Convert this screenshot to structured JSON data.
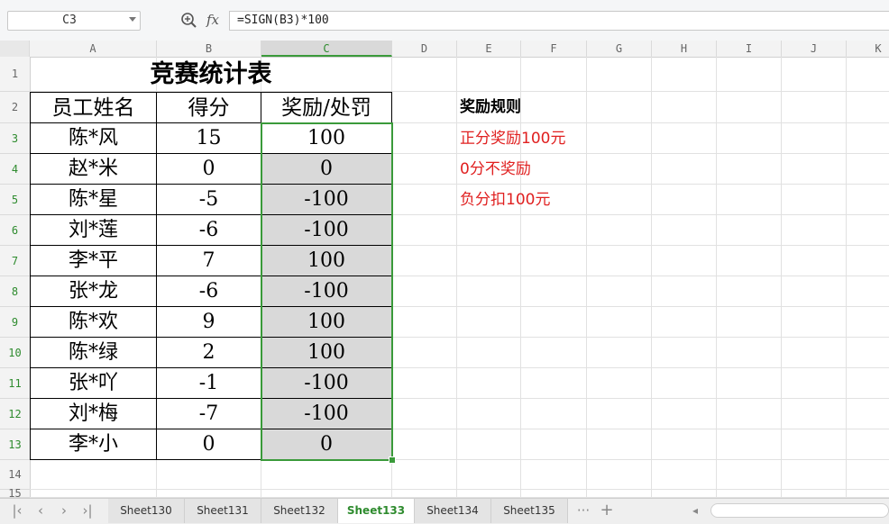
{
  "formula_bar": {
    "name_box": "C3",
    "fx_label": "fx",
    "formula": "=SIGN(B3)*100"
  },
  "columns": [
    "A",
    "B",
    "C",
    "D",
    "E",
    "F",
    "G",
    "H",
    "I",
    "J",
    "K"
  ],
  "selected_column": "C",
  "rows": [
    "1",
    "2",
    "3",
    "4",
    "5",
    "6",
    "7",
    "8",
    "9",
    "10",
    "11",
    "12",
    "13",
    "14",
    "15"
  ],
  "table": {
    "title": "竞赛统计表",
    "headers": [
      "员工姓名",
      "得分",
      "奖励/处罚"
    ],
    "records": [
      {
        "name": "陈*风",
        "score": "15",
        "reward": "100"
      },
      {
        "name": "赵*米",
        "score": "0",
        "reward": "0"
      },
      {
        "name": "陈*星",
        "score": "-5",
        "reward": "-100"
      },
      {
        "name": "刘*莲",
        "score": "-6",
        "reward": "-100"
      },
      {
        "name": "李*平",
        "score": "7",
        "reward": "100"
      },
      {
        "name": "张*龙",
        "score": "-6",
        "reward": "-100"
      },
      {
        "name": "陈*欢",
        "score": "9",
        "reward": "100"
      },
      {
        "name": "陈*绿",
        "score": "2",
        "reward": "100"
      },
      {
        "name": "张*吖",
        "score": "-1",
        "reward": "-100"
      },
      {
        "name": "刘*梅",
        "score": "-7",
        "reward": "-100"
      },
      {
        "name": "李*小",
        "score": "0",
        "reward": "0"
      }
    ]
  },
  "rules": {
    "title": "奖励规则",
    "items": [
      "正分奖励100元",
      "0分不奖励",
      "负分扣100元"
    ],
    "color": "#e02020"
  },
  "sheet_tabs": [
    "Sheet130",
    "Sheet131",
    "Sheet132",
    "Sheet133",
    "Sheet134",
    "Sheet135"
  ],
  "active_tab": "Sheet133",
  "tab_more": "···",
  "tab_add": "+",
  "accent_color": "#3a9a3a"
}
